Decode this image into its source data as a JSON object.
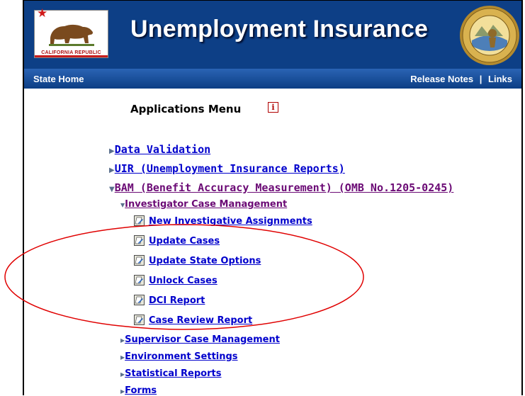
{
  "header": {
    "title": "Unemployment Insurance",
    "flag_text": "CALIFORNIA REPUBLIC",
    "seal_text": "THE GREAT SEAL OF THE STATE OF CALIFORNIA"
  },
  "navbar": {
    "home": "State Home",
    "release_notes": "Release Notes",
    "separator": "|",
    "links": "Links"
  },
  "menu": {
    "heading": "Applications Menu",
    "info_icon": "i",
    "items": [
      {
        "label": "Data Validation",
        "expanded": false
      },
      {
        "label": "UIR (Unemployment Insurance Reports)",
        "expanded": false
      },
      {
        "label": "BAM (Benefit Accuracy Measurement) (OMB No.1205-0245)",
        "expanded": true
      }
    ],
    "bam_children": [
      {
        "label": "Investigator Case Management",
        "expanded": true
      },
      {
        "label": "Supervisor Case Management",
        "expanded": false
      },
      {
        "label": "Environment Settings",
        "expanded": false
      },
      {
        "label": "Statistical Reports",
        "expanded": false
      },
      {
        "label": "Forms",
        "expanded": false
      }
    ],
    "investigator_items": [
      "New Investigative Assignments",
      "Update Cases",
      "Update State Options",
      "Unlock Cases",
      "DCI Report",
      "Case Review Report"
    ]
  },
  "colors": {
    "header_blue": "#0d3f86",
    "link": "#0000cc",
    "visited": "#6b0a75",
    "annotation": "#e00000"
  },
  "icons": {
    "collapsed": "triangle-right-icon",
    "expanded": "triangle-down-icon",
    "document": "document-icon"
  }
}
